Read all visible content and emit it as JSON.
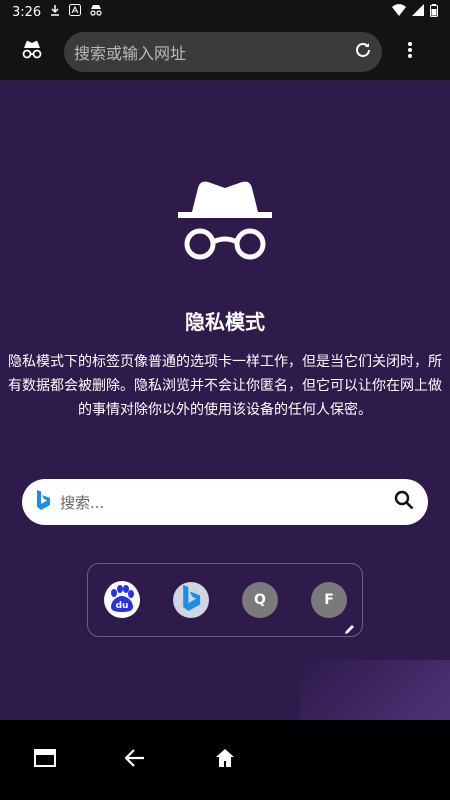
{
  "status_bar": {
    "time": "3:26"
  },
  "toolbar": {
    "url_placeholder": "搜索或输入网址"
  },
  "main": {
    "title": "隐私模式",
    "description": "隐私模式下的标签页像普通的选项卡一样工作，但是当它们关闭时，所有数据都会被删除。隐私浏览并不会让你匿名，但它可以让你在网上做的事情对除你以外的使用该设备的任何人保密。",
    "search_placeholder": "搜索...",
    "shortcuts": [
      {
        "label": "du",
        "icon": "baidu-icon"
      },
      {
        "label": "b",
        "icon": "bing-icon"
      },
      {
        "label": "Q",
        "icon": "letter-tile"
      },
      {
        "label": "F",
        "icon": "letter-tile"
      }
    ]
  },
  "colors": {
    "background": "#2e1a4b",
    "bars": "#131313",
    "urlbar": "#3b3b3b",
    "baidu_blue": "#2932e1",
    "bing_blue": "#1a8ee8"
  }
}
